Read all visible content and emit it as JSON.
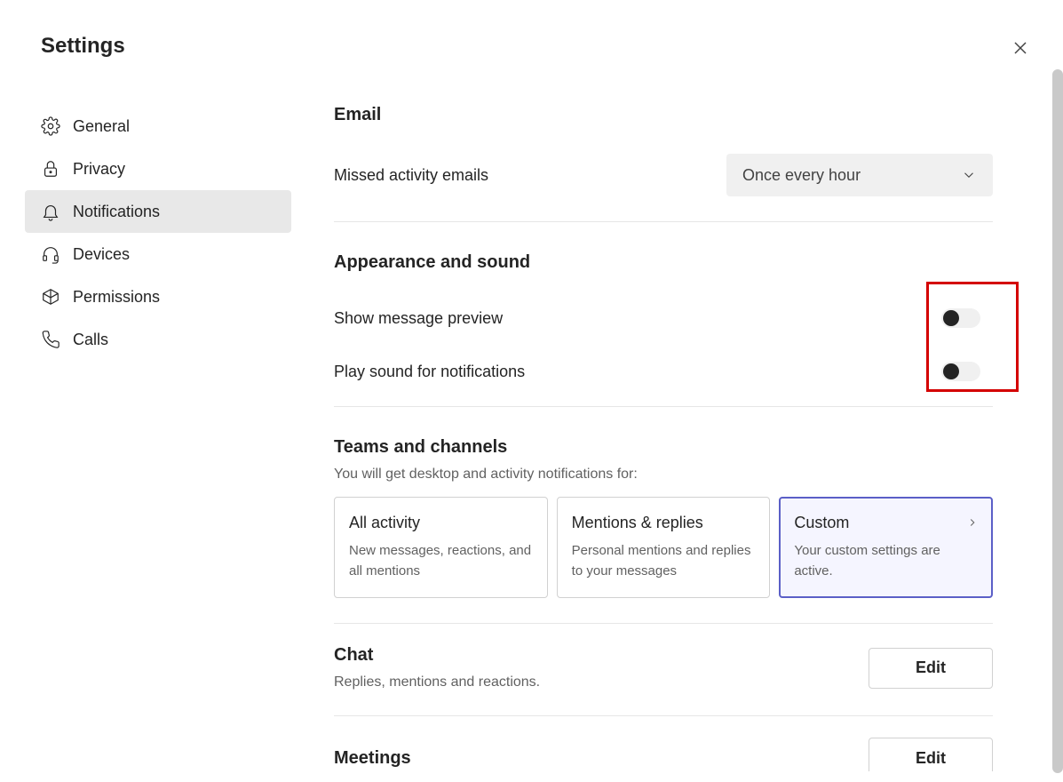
{
  "page": {
    "title": "Settings"
  },
  "sidebar": {
    "items": [
      {
        "label": "General"
      },
      {
        "label": "Privacy"
      },
      {
        "label": "Notifications"
      },
      {
        "label": "Devices"
      },
      {
        "label": "Permissions"
      },
      {
        "label": "Calls"
      }
    ]
  },
  "email": {
    "title": "Email",
    "missed_label": "Missed activity emails",
    "missed_value": "Once every hour"
  },
  "appearance": {
    "title": "Appearance and sound",
    "preview_label": "Show message preview",
    "sound_label": "Play sound for notifications"
  },
  "teams": {
    "title": "Teams and channels",
    "subtext": "You will get desktop and activity notifications for:",
    "cards": [
      {
        "title": "All activity",
        "desc": "New messages, reactions, and all mentions"
      },
      {
        "title": "Mentions & replies",
        "desc": "Personal mentions and replies to your messages"
      },
      {
        "title": "Custom",
        "desc": "Your custom settings are active."
      }
    ]
  },
  "chat": {
    "title": "Chat",
    "subtext": "Replies, mentions and reactions.",
    "edit_label": "Edit"
  },
  "meetings": {
    "title": "Meetings",
    "edit_label": "Edit"
  }
}
